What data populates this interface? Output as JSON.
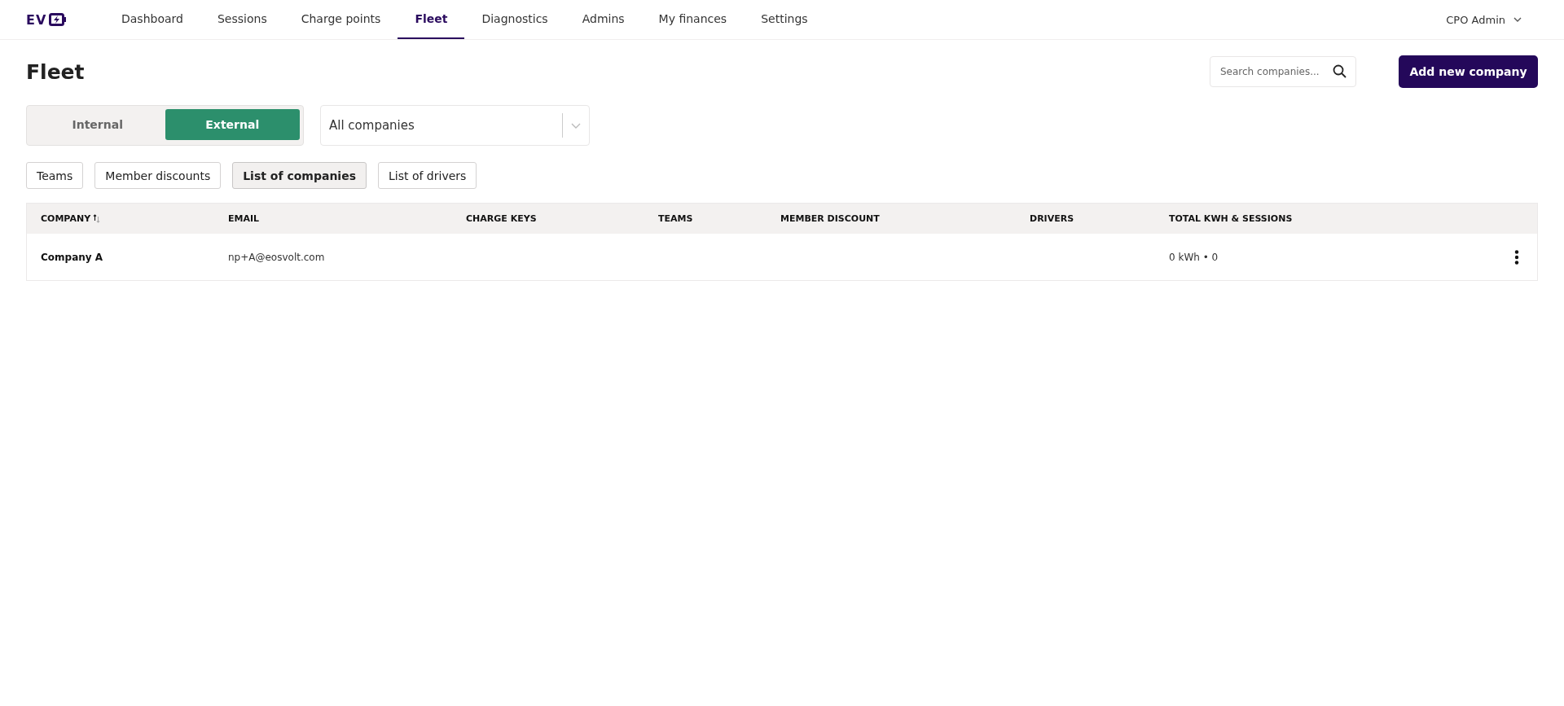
{
  "logo": {
    "text": "EV"
  },
  "nav": [
    {
      "label": "Dashboard",
      "selected": false
    },
    {
      "label": "Sessions",
      "selected": false
    },
    {
      "label": "Charge points",
      "selected": false
    },
    {
      "label": "Fleet",
      "selected": true
    },
    {
      "label": "Diagnostics",
      "selected": false
    },
    {
      "label": "Admins",
      "selected": false
    },
    {
      "label": "My finances",
      "selected": false
    },
    {
      "label": "Settings",
      "selected": false
    }
  ],
  "user_menu": {
    "label": "CPO Admin"
  },
  "page_title": "Fleet",
  "search": {
    "placeholder": "Search companies..."
  },
  "add_button": "Add new company",
  "segments": [
    {
      "label": "Internal",
      "selected": false
    },
    {
      "label": "External",
      "selected": true
    }
  ],
  "company_filter": {
    "value": "All companies"
  },
  "subtabs": [
    {
      "label": "Teams",
      "selected": false
    },
    {
      "label": "Member discounts",
      "selected": false
    },
    {
      "label": "List of companies",
      "selected": true
    },
    {
      "label": "List of drivers",
      "selected": false
    }
  ],
  "table": {
    "columns": [
      {
        "label": "COMPANY",
        "sortable": true
      },
      {
        "label": "EMAIL",
        "sortable": false
      },
      {
        "label": "CHARGE KEYS",
        "sortable": false
      },
      {
        "label": "TEAMS",
        "sortable": false
      },
      {
        "label": "MEMBER DISCOUNT",
        "sortable": false
      },
      {
        "label": "DRIVERS",
        "sortable": false
      },
      {
        "label": "TOTAL KWH & SESSIONS",
        "sortable": false
      }
    ],
    "rows": [
      {
        "cells": [
          "Company A",
          "np+A@eosvolt.com",
          "",
          "",
          "",
          "",
          "0 kWh • 0"
        ]
      }
    ]
  }
}
